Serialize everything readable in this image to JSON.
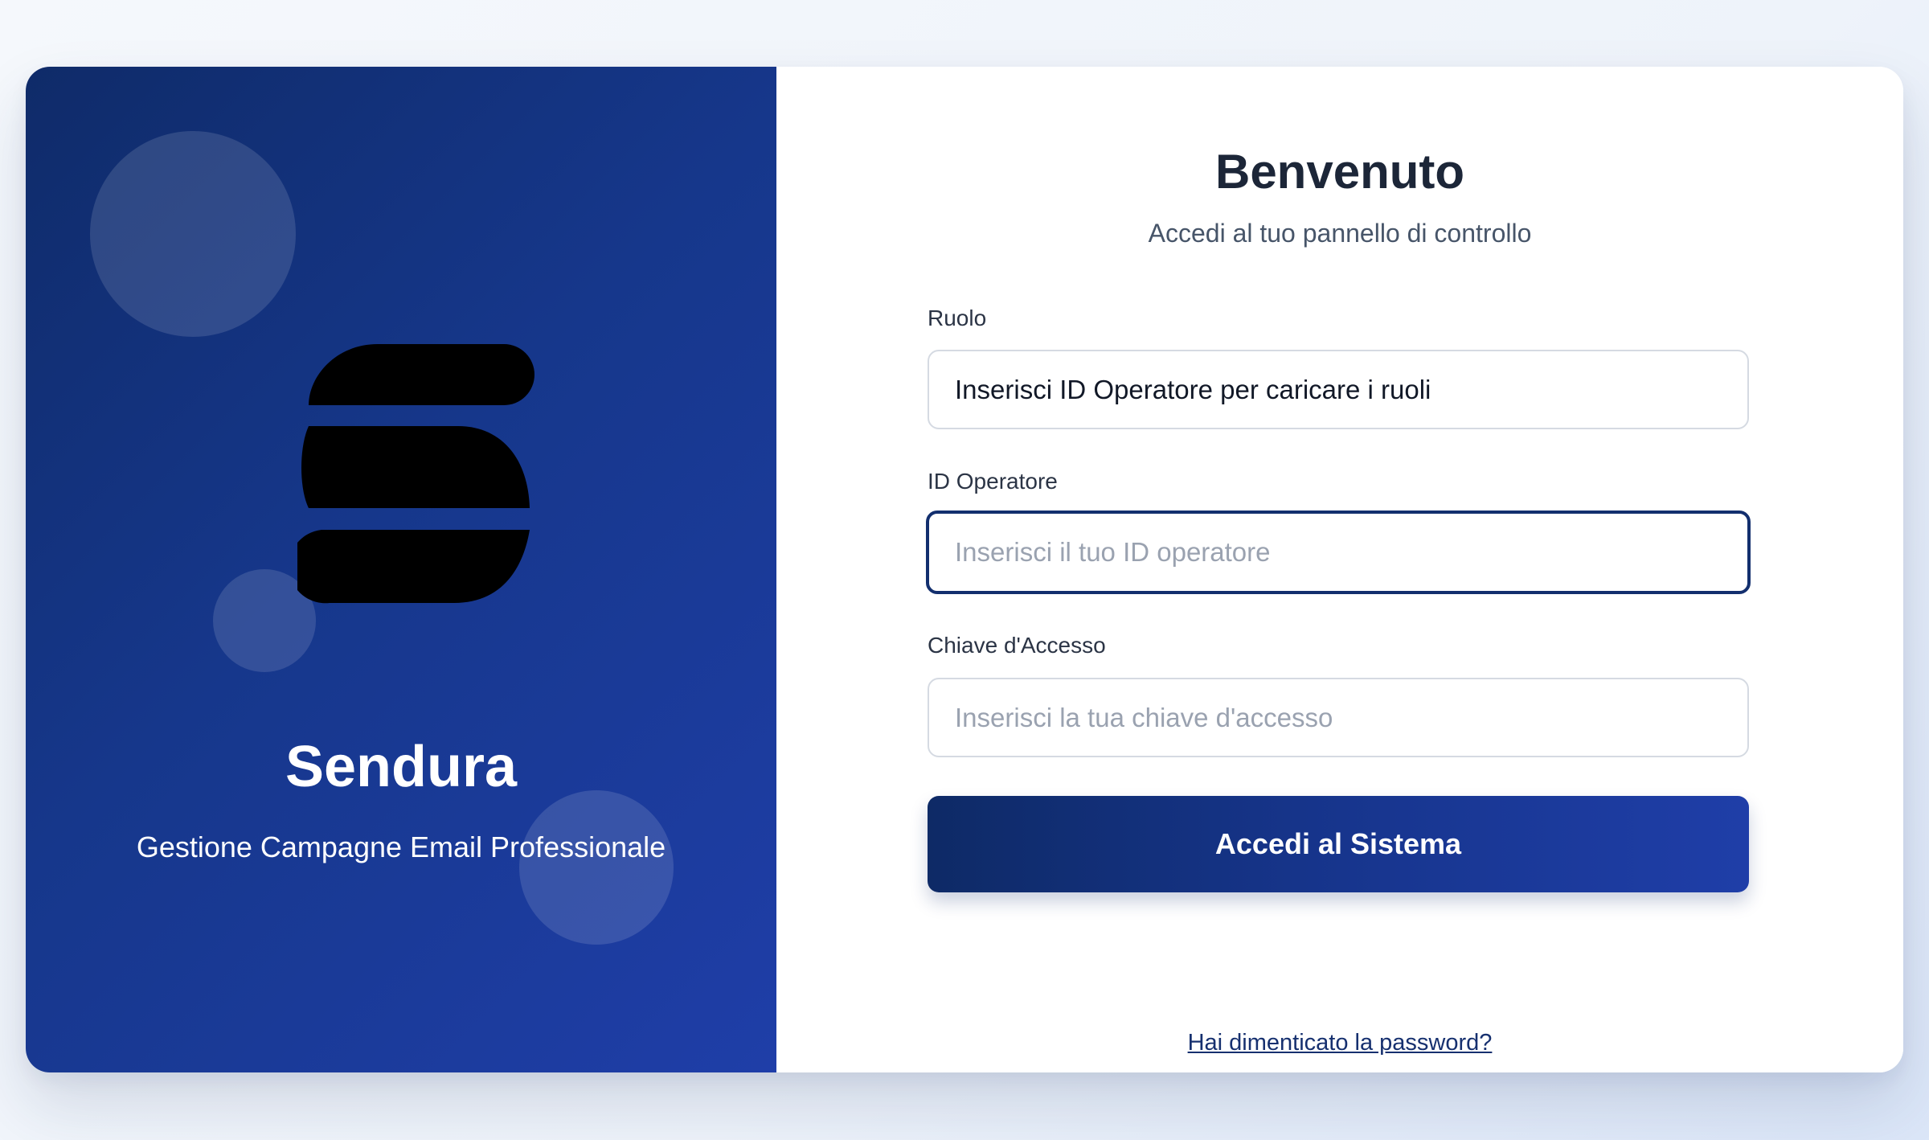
{
  "brand": {
    "name": "Sendura",
    "tagline": "Gestione Campagne Email Professionale",
    "logo_icon": "sendura-s-logo-icon",
    "panel_gradient": [
      "#0f2b69",
      "#1f3ea8"
    ]
  },
  "form": {
    "title": "Benvenuto",
    "subtitle": "Accedi al tuo pannello di controllo",
    "role": {
      "label": "Ruolo",
      "value": "Inserisci ID Operatore per caricare i ruoli"
    },
    "operator_id": {
      "label": "ID Operatore",
      "value": "",
      "placeholder": "Inserisci il tuo ID operatore",
      "focused": true
    },
    "access_key": {
      "label": "Chiave d'Accesso",
      "value": "",
      "placeholder": "Inserisci la tua chiave d'accesso"
    },
    "submit_label": "Accedi al Sistema",
    "forgot_link": "Hai dimenticato la password?"
  },
  "colors": {
    "accent": "#132f6e",
    "title": "#1c2638",
    "focus_border": "#132f6e"
  }
}
